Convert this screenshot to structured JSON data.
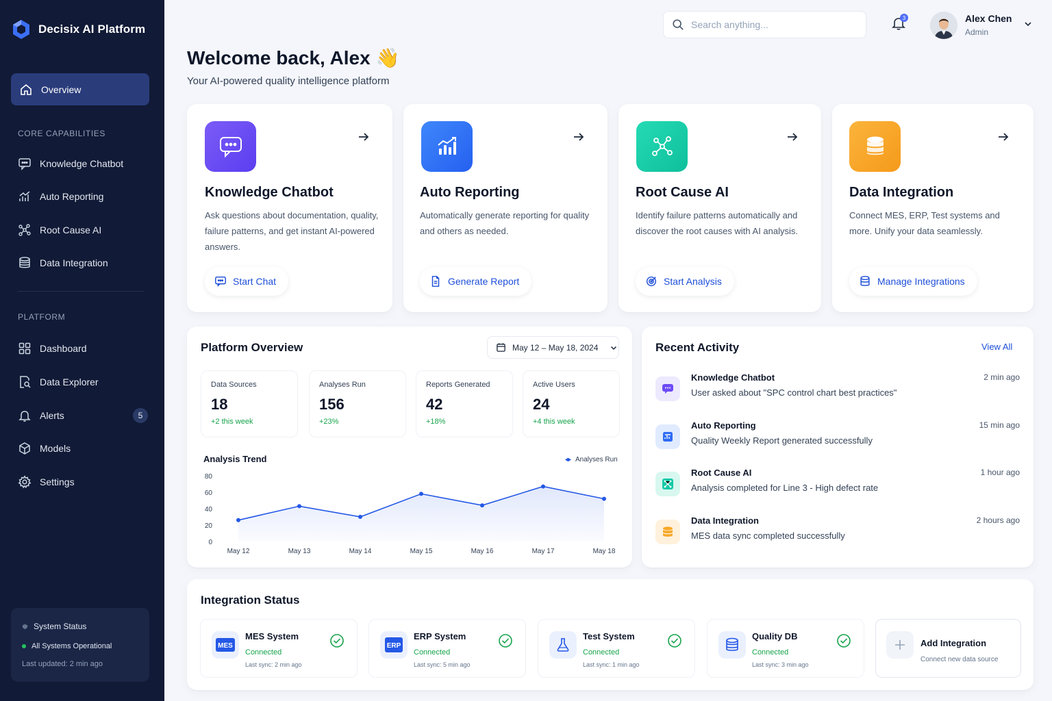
{
  "brand": {
    "name": "Decisix AI Platform"
  },
  "sidebar": {
    "overview": "Overview",
    "core_heading": "CORE CAPABILITIES",
    "core_items": [
      "Knowledge Chatbot",
      "Auto Reporting",
      "Root Cause AI",
      "Data Integration"
    ],
    "platform_heading": "PLATFORM",
    "platform_items": [
      "Dashboard",
      "Data Explorer",
      "Alerts",
      "Models",
      "Settings"
    ],
    "alerts_count": "5",
    "system": {
      "title": "System Status",
      "status": "All Systems Operational",
      "updated": "Last updated: 2 min ago"
    }
  },
  "header": {
    "search_placeholder": "Search anything...",
    "notification_count": "3",
    "user_name": "Alex Chen",
    "user_role": "Admin"
  },
  "welcome": {
    "title": "Welcome back, Alex 👋",
    "subtitle": "Your AI-powered quality intelligence platform"
  },
  "capabilities": [
    {
      "title": "Knowledge Chatbot",
      "desc": "Ask questions about documentation, quality, failure patterns, and get instant AI-powered answers.",
      "button": "Start Chat",
      "color": "#6d4cf5"
    },
    {
      "title": "Auto Reporting",
      "desc": "Automatically generate reporting for quality and others as needed.",
      "button": "Generate Report",
      "color": "#2f6cf6"
    },
    {
      "title": "Root Cause AI",
      "desc": "Identify failure patterns automatically and discover the root causes with AI analysis.",
      "button": "Start Analysis",
      "color": "#14c9a6"
    },
    {
      "title": "Data Integration",
      "desc": "Connect MES, ERP, Test systems and more. Unify your data seamlessly.",
      "button": "Manage Integrations",
      "color": "#f7a829"
    }
  ],
  "overview": {
    "title": "Platform Overview",
    "date_range": "May 12 – May 18, 2024",
    "stats": [
      {
        "label": "Data Sources",
        "value": "18",
        "delta": "+2 this week"
      },
      {
        "label": "Analyses Run",
        "value": "156",
        "delta": "+23%"
      },
      {
        "label": "Reports Generated",
        "value": "42",
        "delta": "+18%"
      },
      {
        "label": "Active Users",
        "value": "24",
        "delta": "+4 this week"
      }
    ],
    "trend_title": "Analysis Trend",
    "legend": "Analyses Run"
  },
  "chart_data": {
    "type": "area",
    "categories": [
      "May 12",
      "May 13",
      "May 14",
      "May 15",
      "May 16",
      "May 17",
      "May 18"
    ],
    "series": [
      {
        "name": "Analyses Run",
        "values": [
          26,
          43,
          30,
          58,
          44,
          67,
          52
        ]
      }
    ],
    "yticks": [
      "0",
      "20",
      "40",
      "60",
      "80"
    ],
    "ylim": [
      0,
      80
    ],
    "grid": false,
    "legend_position": "top-right",
    "color": "#2458e6"
  },
  "activity": {
    "title": "Recent Activity",
    "view_all": "View All",
    "items": [
      {
        "title": "Knowledge Chatbot",
        "desc": "User asked about \"SPC control chart best practices\"",
        "time": "2 min ago"
      },
      {
        "title": "Auto Reporting",
        "desc": "Quality Weekly Report generated successfully",
        "time": "15 min ago"
      },
      {
        "title": "Root Cause AI",
        "desc": "Analysis completed for Line 3 - High defect rate",
        "time": "1 hour ago"
      },
      {
        "title": "Data Integration",
        "desc": "MES data sync completed successfully",
        "time": "2 hours ago"
      }
    ]
  },
  "integrations": {
    "title": "Integration Status",
    "items": [
      {
        "name": "MES System",
        "badge": "MES",
        "status": "Connected",
        "sync": "Last sync: 2 min ago"
      },
      {
        "name": "ERP System",
        "badge": "ERP",
        "status": "Connected",
        "sync": "Last sync: 5 min ago"
      },
      {
        "name": "Test System",
        "status": "Connected",
        "sync": "Last sync: 1 min ago"
      },
      {
        "name": "Quality DB",
        "status": "Connected",
        "sync": "Last sync: 3 min ago"
      }
    ],
    "add_title": "Add Integration",
    "add_desc": "Connect new data source"
  }
}
